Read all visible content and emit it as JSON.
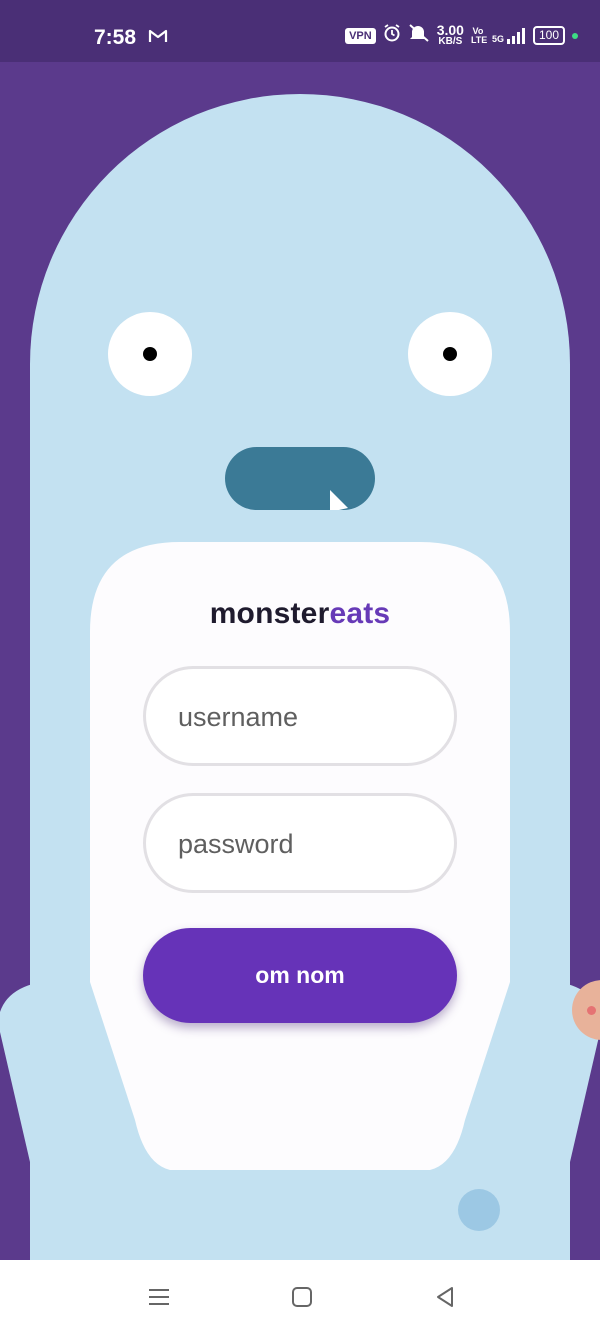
{
  "status_bar": {
    "time": "7:58",
    "vpn": "VPN",
    "speed_value": "3.00",
    "speed_unit": "KB/S",
    "volte": "Vo LTE",
    "network": "5G",
    "battery": "100",
    "icons": [
      "gmail-icon",
      "alarm-icon",
      "mute-icon",
      "signal-icon",
      "battery-icon"
    ]
  },
  "brand": {
    "part1": "monster",
    "part2": "eats"
  },
  "form": {
    "username_placeholder": "username",
    "password_placeholder": "password",
    "submit_label": "om nom"
  },
  "nav": {
    "icons": [
      "menu-icon",
      "home-icon",
      "back-icon"
    ]
  },
  "colors": {
    "background": "#5b3a8c",
    "monster": "#c3e1f1",
    "mouth": "#3b7a96",
    "accent": "#673ab7",
    "button": "#6633b8"
  }
}
